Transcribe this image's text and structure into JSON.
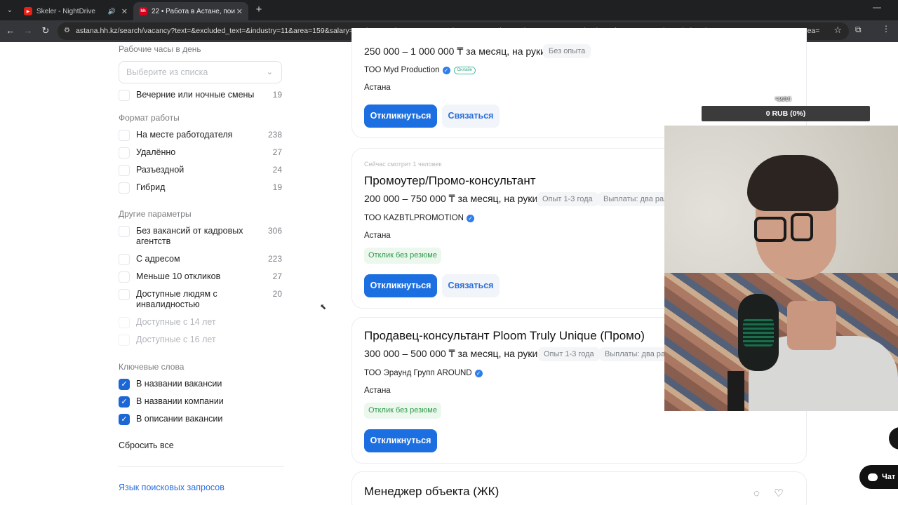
{
  "browser": {
    "tabs": [
      {
        "title": "Skeler - NightDrive",
        "audio": "🔊",
        "active": false
      },
      {
        "title": "22 • Работа в Астане, поиск п...",
        "active": true
      }
    ],
    "url": "astana.hh.kz/search/vacancy?text=&excluded_text=&industry=11&area=159&salary=&salary_mode=&currency_code=KZT&experience=doesNotMatter&order_by=relevance&search_period=0&items_on_page=50&L_save_area=true&hht..."
  },
  "filters": {
    "work_hours": {
      "heading": "Рабочие часы в день",
      "placeholder": "Выберите из списка",
      "options": [
        {
          "label": "Вечерние или ночные смены",
          "count": "19"
        }
      ]
    },
    "work_format": {
      "heading": "Формат работы",
      "options": [
        {
          "label": "На месте работодателя",
          "count": "238"
        },
        {
          "label": "Удалённо",
          "count": "27"
        },
        {
          "label": "Разъездной",
          "count": "24"
        },
        {
          "label": "Гибрид",
          "count": "19"
        }
      ]
    },
    "other": {
      "heading": "Другие параметры",
      "options": [
        {
          "label": "Без вакансий от кадровых агентств",
          "count": "306"
        },
        {
          "label": "С адресом",
          "count": "223"
        },
        {
          "label": "Меньше 10 откликов",
          "count": "27"
        },
        {
          "label": "Доступные людям с инвалидностью",
          "count": "20"
        },
        {
          "label": "Доступные с 14 лет",
          "count": ""
        },
        {
          "label": "Доступные с 16 лет",
          "count": ""
        }
      ]
    },
    "keywords": {
      "heading": "Ключевые слова",
      "options": [
        {
          "label": "В названии вакансии",
          "checked": true
        },
        {
          "label": "В названии компании",
          "checked": true
        },
        {
          "label": "В описании вакансии",
          "checked": true
        }
      ]
    },
    "reset_label": "Сбросить все",
    "search_lang_label": "Язык поисковых запросов"
  },
  "vacancies": [
    {
      "salary": "250 000 – 1 000 000 ₸ за месяц, на руки",
      "experience": "Без опыта",
      "company": "ТОО Myd Production",
      "online_badge": "Онлайн",
      "city": "Астана",
      "apply_label": "Откликнуться",
      "contact_label": "Связаться"
    },
    {
      "watching": "Сейчас смотрит 1 человек",
      "title": "Промоутер/Промо-консультант",
      "salary": "200 000 – 750 000 ₸ за месяц, на руки",
      "experience": "Опыт 1-3 года",
      "payouts": "Выплаты: два раза",
      "company": "ТОО KAZBTLPROMOTION",
      "city": "Астана",
      "no_resume": "Отклик без резюме",
      "apply_label": "Откликнуться",
      "contact_label": "Связаться"
    },
    {
      "title": "Продавец-консультант Ploom Truly Unique (Промо)",
      "salary": "300 000 – 500 000 ₸ за месяц, на руки",
      "experience": "Опыт 1-3 года",
      "payouts": "Выплаты: два раза",
      "company": "ТОО Эраунд Групп AROUND",
      "city": "Астана",
      "no_resume": "Отклик без резюме",
      "apply_label": "Откликнуться"
    },
    {
      "title": "Менеджер объекта (ЖК)"
    }
  ],
  "overlay": {
    "donate_label": "чилл",
    "donate_progress": "0 RUB (0%)",
    "chat_label": "Чат"
  }
}
